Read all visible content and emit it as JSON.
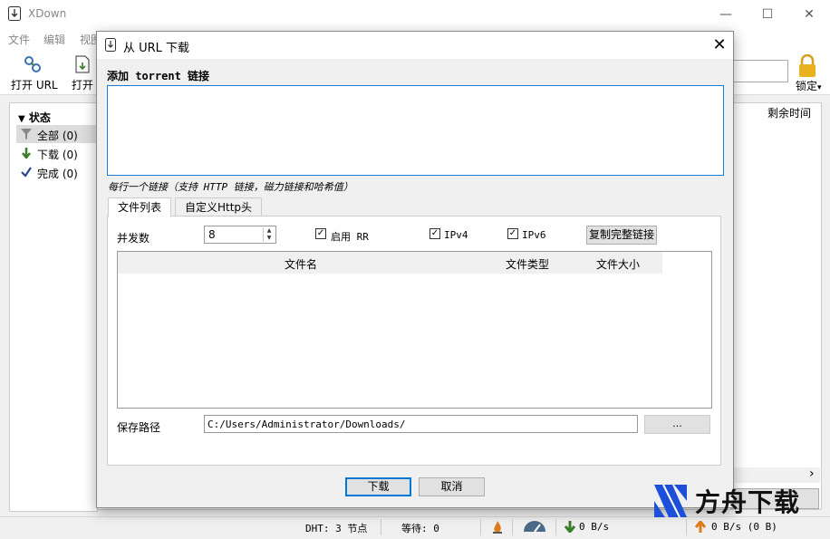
{
  "window": {
    "title": "XDown",
    "minimize": "—",
    "maximize": "☐",
    "close": "✕"
  },
  "menu": {
    "items": [
      "文件",
      "编辑",
      "视图"
    ]
  },
  "toolbar": {
    "open_url_label": "打开 URL",
    "open_label": "打开",
    "lock_label": "锁定",
    "lock_arrow": "▾"
  },
  "sidebar": {
    "header": "状态",
    "items": [
      {
        "label": "全部 (0)",
        "icon": "filter-icon"
      },
      {
        "label": "下载 (0)",
        "icon": "arrow-down-icon"
      },
      {
        "label": "完成 (0)",
        "icon": "check-icon"
      }
    ]
  },
  "content": {
    "remaining_time_header": "剩余时间",
    "scroll_arrow": "›"
  },
  "statusbar": {
    "dht": "DHT: 3 节点",
    "waiting": "等待: 0",
    "download_speed": "0 B/s",
    "upload_speed": "0 B/s (0 B)"
  },
  "dialog": {
    "title": "从 URL 下载",
    "close": "✕",
    "torrent_label": "添加 torrent 链接",
    "url_text": "",
    "hint": "每行一个链接（支持 HTTP 链接，磁力链接和哈希值）",
    "tabs": [
      {
        "label": "文件列表",
        "active": true
      },
      {
        "label": "自定义Http头",
        "active": false
      }
    ],
    "concurrency_label": "并发数",
    "concurrency_value": "8",
    "checkboxes": [
      {
        "label": "启用 RR",
        "checked": true
      },
      {
        "label": "IPv4",
        "checked": true
      },
      {
        "label": "IPv6",
        "checked": true
      }
    ],
    "copy_link_button": "复制完整链接",
    "table_headers": {
      "name": "文件名",
      "type": "文件类型",
      "size": "文件大小"
    },
    "save_path_label": "保存路径",
    "save_path_value": "C:/Users/Administrator/Downloads/",
    "browse_button": "...",
    "download_button": "下载",
    "cancel_button": "取消"
  },
  "watermark": {
    "text": "方舟下载"
  },
  "colors": {
    "accent": "#0078d7",
    "watermark_blue": "#1e4fd8",
    "green": "#3a7d2a",
    "orange": "#e07b1a"
  }
}
